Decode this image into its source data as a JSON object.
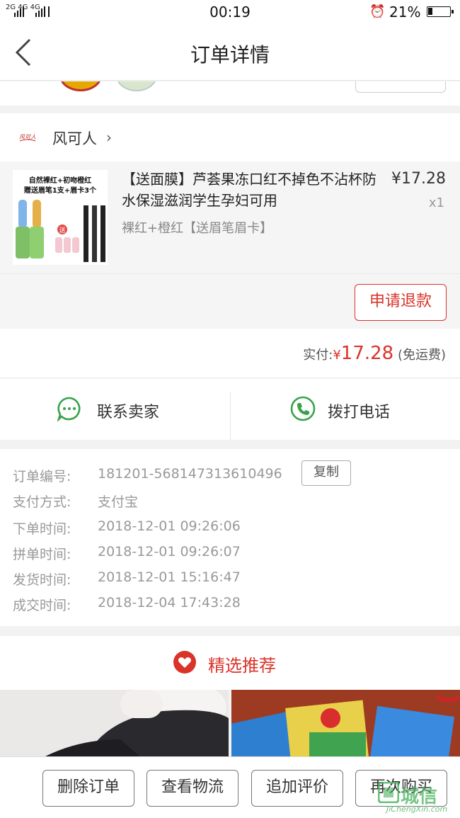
{
  "status_bar": {
    "network": "2G 4G 4G",
    "time": "00:19",
    "battery": "21%"
  },
  "nav": {
    "title": "订单详情"
  },
  "store": {
    "logo_text": "风可人",
    "name": "风可人",
    "chevron": "›"
  },
  "product": {
    "image_caption_1": "自然裸红+初吻橙红",
    "image_caption_2": "赠送眉笔1支+眉卡3个",
    "image_badge": "送",
    "title": "【送面膜】芦荟果冻口红不掉色不沾杯防水保湿滋润学生孕妇可用",
    "sku": "裸红+橙红【送眉笔眉卡】",
    "price": "¥17.28",
    "qty": "x1"
  },
  "refund_button": "申请退款",
  "payment": {
    "label": "实付:",
    "currency": "¥",
    "amount": "17.28",
    "note": "(免运费)"
  },
  "contact": {
    "seller_label": "联系卖家",
    "call_label": "拨打电话"
  },
  "order_info": {
    "copy_label": "复制",
    "rows": [
      {
        "label": "订单编号:",
        "value": "181201-568147313610496"
      },
      {
        "label": "支付方式:",
        "value": "支付宝"
      },
      {
        "label": "下单时间:",
        "value": "2018-12-01 09:26:06"
      },
      {
        "label": "拼单时间:",
        "value": "2018-12-01 09:26:07"
      },
      {
        "label": "发货时间:",
        "value": "2018-12-01 15:16:47"
      },
      {
        "label": "成交时间:",
        "value": "2018-12-04 17:43:28"
      }
    ]
  },
  "recommend": {
    "title": "精选推荐"
  },
  "bottom_buttons": [
    "删除订单",
    "查看物流",
    "追加评价",
    "再次购买"
  ],
  "watermark": {
    "title": "城信",
    "site": "JiChengXin.com"
  },
  "colors": {
    "accent": "#d9332a",
    "contact_green": "#3aa24a"
  }
}
